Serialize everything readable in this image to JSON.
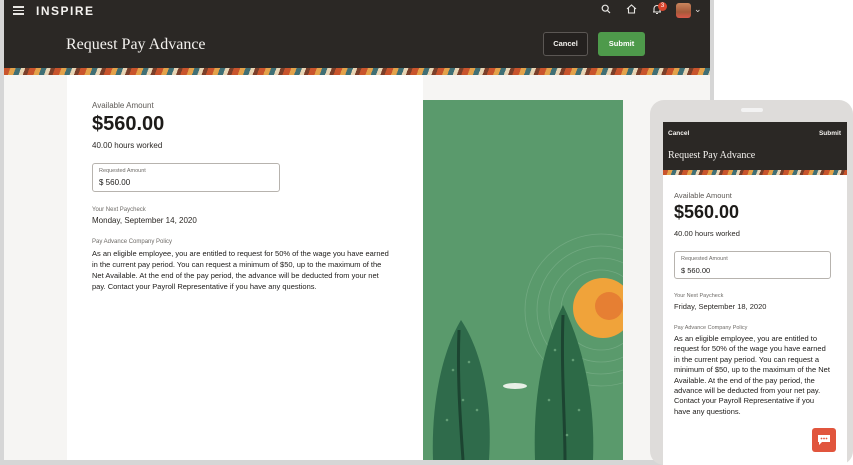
{
  "brand": "INSPIRE",
  "notifications_count": "3",
  "page": {
    "title": "Request Pay Advance",
    "cancel_label": "Cancel",
    "submit_label": "Submit"
  },
  "form": {
    "available_label": "Available Amount",
    "available_amount": "$560.00",
    "hours_worked": "40.00 hours worked",
    "requested_label": "Requested Amount",
    "requested_value": "$ 560.00",
    "next_paycheck_label": "Your Next Paycheck",
    "next_paycheck_date": "Monday, September 14, 2020",
    "policy_label": "Pay Advance Company Policy",
    "policy_text": "As an eligible employee, you are entitled to request for 50% of the wage you have earned in the current pay period. You can request a minimum of $50, up to the maximum of the Net Available. At the end of the pay period, the advance will be deducted from your net pay. Contact your Payroll Representative if you have any questions."
  },
  "mobile": {
    "cancel_label": "Cancel",
    "submit_label": "Submit",
    "title": "Request Pay Advance",
    "available_label": "Available Amount",
    "available_amount": "$560.00",
    "hours_worked": "40.00 hours worked",
    "requested_label": "Requested Amount",
    "requested_value": "$ 560.00",
    "next_paycheck_label": "Your Next Paycheck",
    "next_paycheck_date": "Friday, September 18, 2020",
    "policy_label": "Pay Advance Company Policy",
    "policy_text": "As an eligible employee, you are entitled to request for 50% of the wage you have earned in the current pay period. You can request a minimum of $50, up to the maximum of the Net Available. At the end of the pay period, the advance will be deducted from your net pay. Contact your Payroll Representative if you have any questions."
  },
  "icons": {
    "menu": "hamburger-menu-icon",
    "search": "search-icon",
    "home": "home-icon",
    "notifications": "notification-bell-icon",
    "profile": "user-avatar",
    "chat": "chat-icon"
  },
  "colors": {
    "header_bg": "#2b2825",
    "submit_green": "#4e9a4b",
    "art_green": "#5a9a6c",
    "sun_orange": "#f0a33a",
    "chat_red": "#e1553d"
  }
}
